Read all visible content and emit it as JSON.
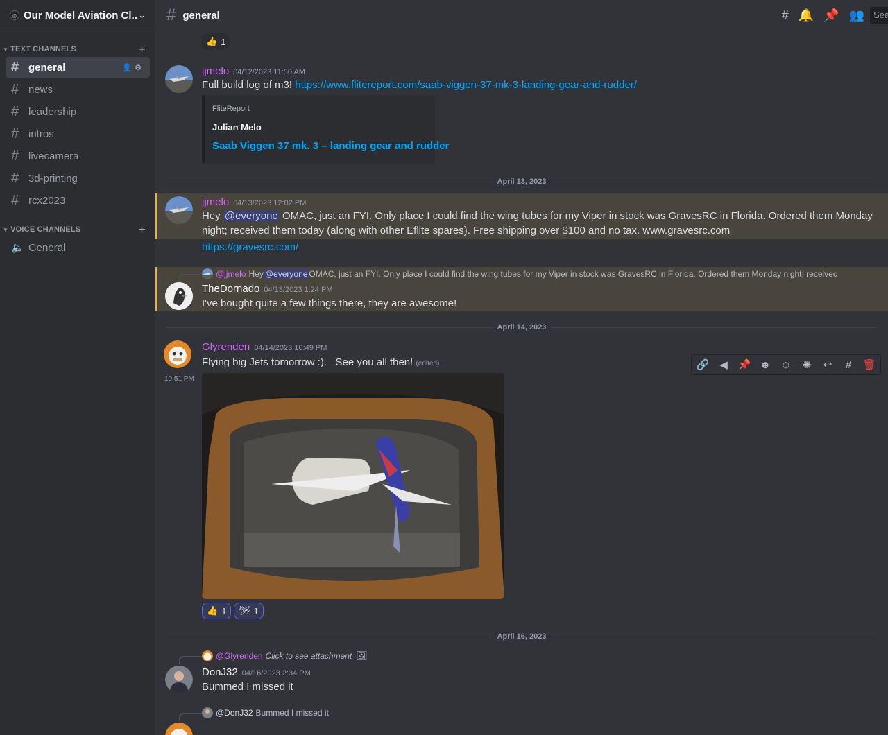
{
  "server": {
    "name": "Our Model Aviation Cl..."
  },
  "categories": {
    "text": "TEXT CHANNELS",
    "voice": "VOICE CHANNELS"
  },
  "text_channels": [
    "general",
    "news",
    "leadership",
    "intros",
    "livecamera",
    "3d-printing",
    "rcx2023"
  ],
  "voice_channels": [
    "General"
  ],
  "topbar": {
    "channel": "general",
    "search_placeholder": "Sea"
  },
  "colors": {
    "accent": "#5865f2",
    "link": "#00a8fc",
    "highlight": "#f0b232",
    "jjmelo": "#d268f7",
    "glyrenden": "#d268f7"
  },
  "messages": {
    "top_reaction": {
      "emoji": "👍",
      "count": "1"
    },
    "m1": {
      "user": "jjmelo",
      "time": "04/12/2023 11:50 AM",
      "text": "Full build log of m3! ",
      "link": "https://www.flitereport.com/saab-viggen-37-mk-3-landing-gear-and-rudder/",
      "embed": {
        "provider": "FliteReport",
        "author": "Julian Melo",
        "title": "Saab Viggen 37 mk. 3 – landing gear and rudder"
      }
    },
    "divider1": "April 13, 2023",
    "m2": {
      "user": "jjmelo",
      "time": "04/13/2023 12:02 PM",
      "pre": "Hey ",
      "mention": "@everyone",
      "line1": " OMAC, just an FYI. Only place I could find the wing tubes for my Viper in stock was GravesRC in Florida. Ordered them Monday",
      "line2": "night; received them today (along with other Eflite spares). Free shipping over $100 and no tax. www.gravesrc.com",
      "link": "https://gravesrc.com/"
    },
    "m3": {
      "reply_user": "@jjmelo",
      "reply_pre": "Hey ",
      "reply_mention": "@everyone",
      "reply_text": " OMAC, just an FYI. Only place I could find the wing tubes for my Viper in stock was GravesRC in Florida. Ordered them Monday night; receivec",
      "user": "TheDornado",
      "time": "04/13/2023 1:24 PM",
      "text": "I've bought quite a few things there, they are awesome!"
    },
    "divider2": "April 14, 2023",
    "m4": {
      "user": "Glyrenden",
      "time": "04/14/2023 10:49 PM",
      "text": "Flying big Jets tomorrow :).   See you all then! ",
      "edited": "(edited)",
      "side_time": "10:51 PM",
      "reactions": [
        {
          "emoji": "👍",
          "count": "1"
        },
        {
          "emoji": "🛩",
          "count": "1"
        }
      ]
    },
    "divider3": "April 16, 2023",
    "m5": {
      "reply_user": "@Glyrenden",
      "reply_text": "Click to see attachment",
      "user": "DonJ32",
      "time": "04/16/2023 2:34 PM",
      "text": "Bummed I missed it"
    },
    "m6": {
      "reply_user": "@DonJ32",
      "reply_text": "Bummed I missed it"
    }
  },
  "icons": [
    "threads-icon",
    "bell-icon",
    "pin-icon",
    "members-icon",
    "link-icon",
    "forward-icon",
    "pin-icon",
    "reaction-icon",
    "super-reaction-icon",
    "emoji-icon",
    "reply-icon",
    "thread-icon",
    "trash-icon"
  ]
}
